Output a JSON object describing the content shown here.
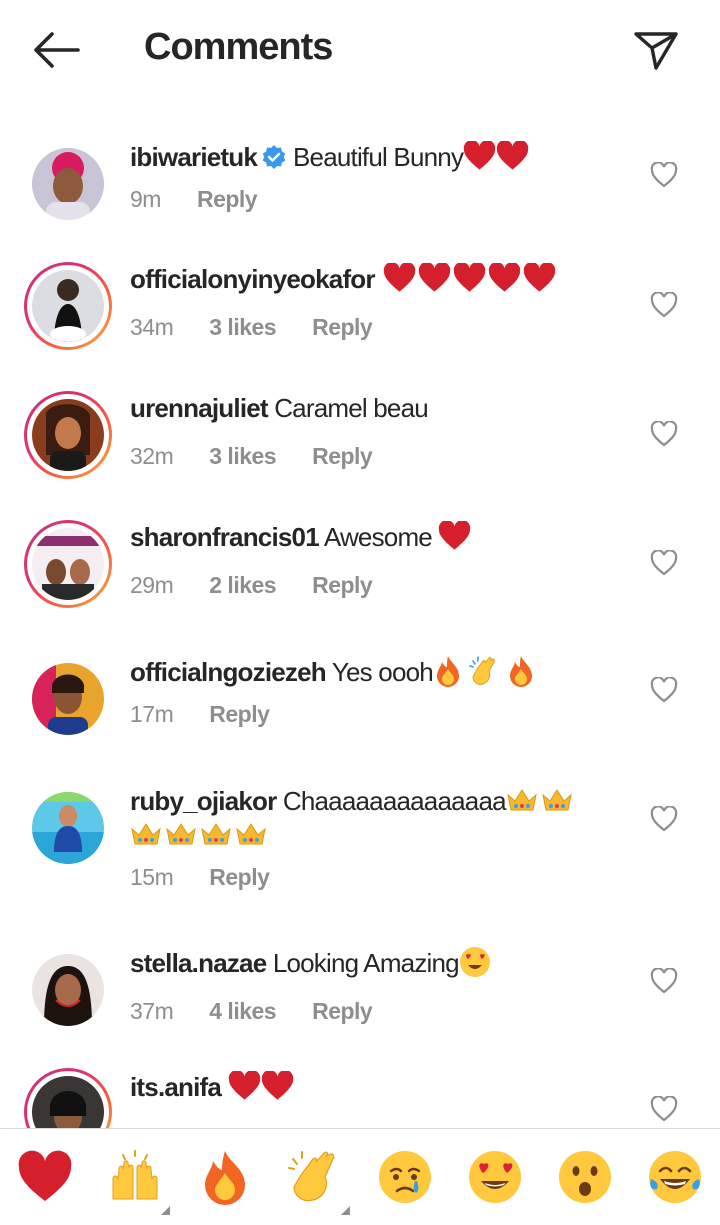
{
  "header": {
    "title": "Comments"
  },
  "comments": [
    {
      "username": "ibiwarietuk",
      "text": "Beautiful Bunny",
      "verified": true,
      "time": "9m",
      "likes": "",
      "reply": "Reply",
      "ring": false,
      "emojis": [
        "red-heart",
        "red-heart"
      ]
    },
    {
      "username": "officialonyinyeokafor",
      "text": "",
      "verified": false,
      "time": "34m",
      "likes": "3 likes",
      "reply": "Reply",
      "ring": true,
      "emojis": [
        "red-heart",
        "red-heart",
        "red-heart",
        "red-heart",
        "red-heart"
      ]
    },
    {
      "username": "urennajuliet",
      "text": "Caramel beau",
      "verified": false,
      "time": "32m",
      "likes": "3 likes",
      "reply": "Reply",
      "ring": true,
      "emojis": []
    },
    {
      "username": "sharonfrancis01",
      "text": "Awesome",
      "verified": false,
      "time": "29m",
      "likes": "2 likes",
      "reply": "Reply",
      "ring": true,
      "emojis": [
        "red-heart"
      ]
    },
    {
      "username": "officialngoziezeh",
      "text": "Yes oooh",
      "verified": false,
      "time": "17m",
      "likes": "",
      "reply": "Reply",
      "ring": false,
      "emojis": [
        "fire",
        "clapping-hands",
        "fire"
      ]
    },
    {
      "username": "ruby_ojiakor",
      "text": "Chaaaaaaaaaaaaaa",
      "verified": false,
      "time": "15m",
      "likes": "",
      "reply": "Reply",
      "ring": false,
      "emojis": [
        "crown",
        "crown",
        "crown",
        "crown",
        "crown",
        "crown"
      ]
    },
    {
      "username": "stella.nazae",
      "text": "Looking Amazing",
      "verified": false,
      "time": "37m",
      "likes": "4 likes",
      "reply": "Reply",
      "ring": false,
      "emojis": [
        "heart-eyes-face"
      ]
    },
    {
      "username": "its.anifa",
      "text": "",
      "verified": false,
      "time": "",
      "likes": "",
      "reply": "",
      "ring": true,
      "emojis": [
        "red-heart",
        "red-heart"
      ]
    }
  ],
  "emoji_bar": [
    "red-heart",
    "raising-hands",
    "fire",
    "clapping-hands",
    "crying-face",
    "heart-eyes-face",
    "surprised-face",
    "tears-of-joy-face"
  ],
  "colors": {
    "accent_ring_start": "#c13584",
    "accent_ring_end": "#fcaf45",
    "verified_blue": "#3897f0",
    "meta_gray": "#8e8e8e"
  }
}
